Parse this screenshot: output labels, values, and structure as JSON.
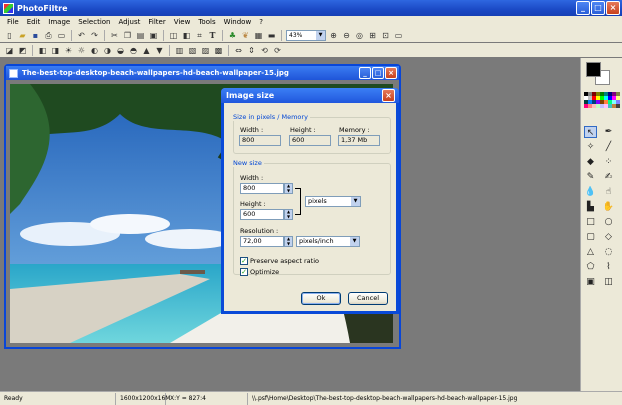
{
  "app": {
    "title": "PhotoFiltre"
  },
  "menu": [
    "File",
    "Edit",
    "Image",
    "Selection",
    "Adjust",
    "Filter",
    "View",
    "Tools",
    "Window",
    "?"
  ],
  "toolbar": {
    "zoom_value": "43%"
  },
  "document": {
    "title": "The-best-top-desktop-beach-wallpapers-hd-beach-wallpaper-15.jpg"
  },
  "dialog": {
    "title": "Image size",
    "memory_group": "Size in pixels / Memory",
    "width_label": "Width :",
    "height_label": "Height :",
    "memory_label": "Memory :",
    "width_value": "800",
    "height_value": "600",
    "memory_value": "1,37 Mb",
    "new_group": "New size",
    "new_width_label": "Width :",
    "new_width_value": "800",
    "new_height_label": "Height :",
    "new_height_value": "600",
    "unit_value": "pixels",
    "resolution_label": "Resolution :",
    "resolution_value": "72,00",
    "resolution_unit": "pixels/inch",
    "preserve_label": "Preserve aspect ratio",
    "optimize_label": "Optimize",
    "preserve_checked": true,
    "optimize_checked": true,
    "ok_label": "Ok",
    "cancel_label": "Cancel"
  },
  "status": {
    "state": "Ready",
    "image_info": "1600x1200x16M",
    "coords": "X:Y = 827:4",
    "path": "\\\\.psf\\Home\\Desktop\\The-best-top-desktop-beach-wallpapers-hd-beach-wallpaper-15.jpg"
  },
  "palette_colors": [
    "#000000",
    "#808080",
    "#800000",
    "#808000",
    "#008000",
    "#008080",
    "#000080",
    "#800080",
    "#808040",
    "#ffffff",
    "#c0c0c0",
    "#ff0000",
    "#ffff00",
    "#00ff00",
    "#00ffff",
    "#0000ff",
    "#ff00ff",
    "#ffff80",
    "#004040",
    "#0080ff",
    "#004080",
    "#8000ff",
    "#804000",
    "#ff8040",
    "#00ff80",
    "#80ffff",
    "#8080ff",
    "#ff0080",
    "#ff8080",
    "#ffc0c0",
    "#c0ffc0",
    "#c0c0ff",
    "#ffc0ff",
    "#40c0c0",
    "#c08040",
    "#404040"
  ]
}
